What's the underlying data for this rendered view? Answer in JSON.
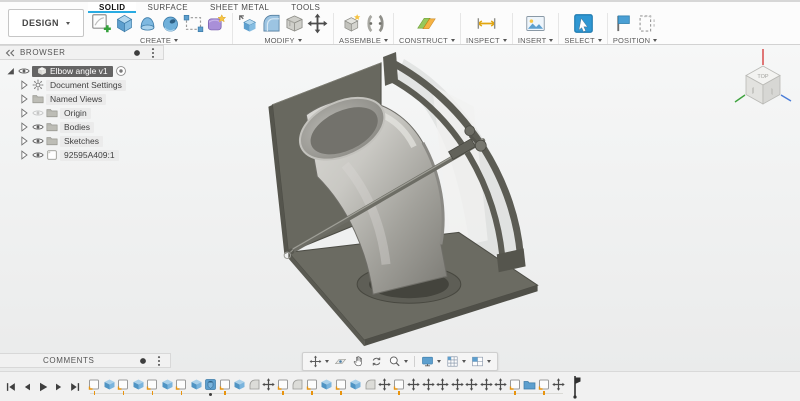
{
  "chrome": {
    "design_button": "DESIGN"
  },
  "tabs": {
    "active": "SOLID",
    "items": [
      "SOLID",
      "SURFACE",
      "SHEET METAL",
      "TOOLS"
    ]
  },
  "toolbar": {
    "groups": [
      {
        "label": "CREATE",
        "icons": [
          "create-sketch",
          "extrude",
          "revolve",
          "sweep",
          "rectangular-pattern",
          "create-form"
        ]
      },
      {
        "label": "MODIFY",
        "icons": [
          "press-pull",
          "fillet",
          "shell",
          "move"
        ]
      },
      {
        "label": "ASSEMBLE",
        "icons": [
          "new-component",
          "joint"
        ]
      },
      {
        "label": "CONSTRUCT",
        "icons": [
          "construct-plane"
        ]
      },
      {
        "label": "INSPECT",
        "icons": [
          "measure"
        ]
      },
      {
        "label": "INSERT",
        "icons": [
          "insert-image"
        ]
      },
      {
        "label": "SELECT",
        "icons": [
          "select"
        ]
      },
      {
        "label": "POSITION",
        "icons": [
          "capture-position",
          "revert-position"
        ]
      }
    ]
  },
  "browser": {
    "title": "BROWSER",
    "rows": [
      {
        "label": "Elbow angle v1",
        "icon": "component",
        "eye": "on",
        "arrow": "expanded",
        "root": true,
        "selected": true,
        "activate": true
      },
      {
        "label": "Document Settings",
        "icon": "gear",
        "eye": null,
        "arrow": "collapsed"
      },
      {
        "label": "Named Views",
        "icon": "folder",
        "eye": null,
        "arrow": "collapsed"
      },
      {
        "label": "Origin",
        "icon": "folder",
        "eye": "off",
        "arrow": "collapsed"
      },
      {
        "label": "Bodies",
        "icon": "folder",
        "eye": "on",
        "arrow": "collapsed"
      },
      {
        "label": "Sketches",
        "icon": "folder",
        "eye": "on",
        "arrow": "collapsed"
      },
      {
        "label": "92595A409:1",
        "icon": "part",
        "eye": "on",
        "arrow": "collapsed"
      }
    ]
  },
  "viewcube": {
    "top_label": "TOP"
  },
  "comments": {
    "title": "COMMENTS"
  },
  "nav": {
    "items": [
      {
        "name": "orbit",
        "caret": true
      },
      {
        "name": "look-at",
        "caret": false
      },
      {
        "name": "pan",
        "caret": false
      },
      {
        "name": "zoom",
        "caret": false
      },
      {
        "name": "zoom-window",
        "caret": true
      },
      {
        "sep": true
      },
      {
        "name": "display-settings",
        "caret": true
      },
      {
        "name": "grid-settings",
        "caret": true
      },
      {
        "name": "viewports",
        "caret": true
      }
    ]
  },
  "timeline": {
    "playback": [
      "skip-start",
      "step-back",
      "play",
      "step-forward",
      "skip-end"
    ],
    "features": [
      "sketch",
      "extrude",
      "sketch",
      "extrude",
      "sketch",
      "extrude",
      "sketch",
      "extrude",
      "hole",
      "sketch",
      "extrude",
      "fillet",
      "move",
      "sketch",
      "fillet",
      "sketch",
      "extrude",
      "sketch",
      "extrude",
      "fillet",
      "move",
      "sketch",
      "move",
      "move",
      "move",
      "move",
      "move",
      "move",
      "move",
      "sketch",
      "folder",
      "sketch",
      "move"
    ]
  },
  "colors": {
    "accent_blue": "#29abe2",
    "icon_blue": "#5d9fce",
    "selection_gray": "#646464",
    "canvas_top": "#f6f7f7",
    "canvas_bottom": "#eaebeb",
    "plate_gray": "#68685f",
    "pipe_metal": "#b9b8b3"
  }
}
